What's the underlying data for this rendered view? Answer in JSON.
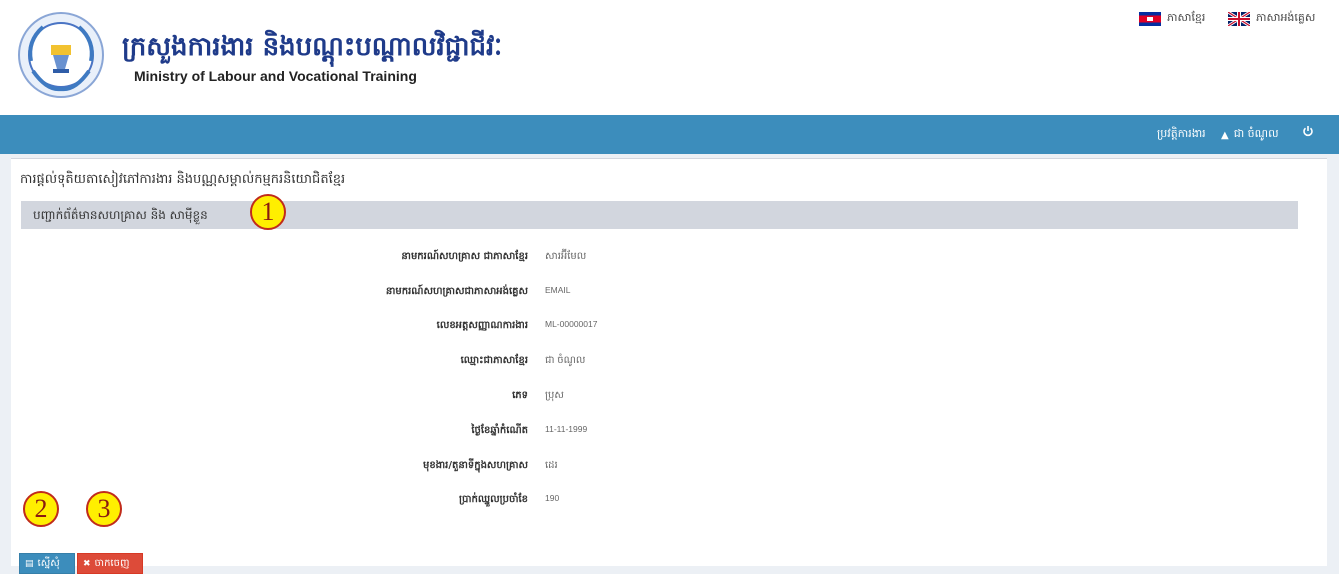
{
  "header": {
    "title_kh": "ក្រសួងការងារ និងបណ្ដុះបណ្ដាលវិជ្ជាជីវៈ",
    "title_en": "Ministry of Labour and Vocational Training",
    "lang_kh": "ភាសាខ្មែរ",
    "lang_en": "ភាសាអង់គ្លេស"
  },
  "navbar": {
    "history": "ប្រវត្តិការងារ",
    "user": "ជា ចំណូល",
    "power_icon": "power-icon"
  },
  "page": {
    "title": "ការផ្តល់ទុតិយតាសៀវភៅការងារ និងបណ្ណសម្គាល់កម្មករនិយោជិតខ្មែរ",
    "section_title": "បញ្ជាក់ព័ត៌មានសហគ្រាស និង សាម៉ីខ្លួន"
  },
  "fields": [
    {
      "label": "នាមករណ៍សហគ្រាស ជាភាសាខ្មែរ",
      "value": "សារអ៊ីមែល"
    },
    {
      "label": "នាមករណ៍សហគ្រាសជាភាសាអង់គ្លេស",
      "value": "EMAIL"
    },
    {
      "label": "លេខអត្តសញ្ញាណការងារ",
      "value": "ML-00000017"
    },
    {
      "label": "ឈ្មោះជាភាសាខ្មែរ",
      "value": "ជា ចំណូល"
    },
    {
      "label": "ភេទ",
      "value": "ប្រុស"
    },
    {
      "label": "ថ្ងៃខែឆ្នាំកំណើត",
      "value": "11-11-1999"
    },
    {
      "label": "មុខងារ/តួនាទីក្នុងសហគ្រាស",
      "value": "ដេរ"
    },
    {
      "label": "ប្រាក់ឈ្នួលប្រចាំខែ",
      "value": "190"
    }
  ],
  "actions": {
    "save_label": "ស្នើសុំ",
    "cancel_label": "ចាកចេញ"
  },
  "markers": [
    "1",
    "2",
    "3"
  ],
  "colors": {
    "navbar": "#3c8dbc",
    "primary": "#3c8dbc",
    "danger": "#dd4b39",
    "section": "#d2d6de",
    "marker": "#ffef00"
  }
}
